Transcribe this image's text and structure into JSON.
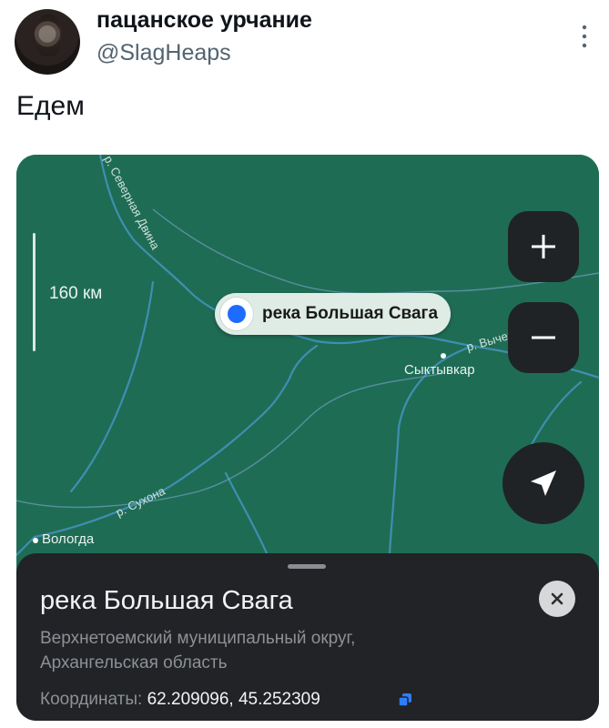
{
  "tweet": {
    "display_name": "пацанское урчание",
    "handle": "@SlagHeaps",
    "text": "Едем"
  },
  "map": {
    "scale_label": "160 км",
    "selected_place_label": "река Большая Свага",
    "cities": {
      "syktyvkar": "Сыктывкар",
      "vologda": "Вологда"
    },
    "rivers": {
      "severnaya_dvina": "р. Северная Двина",
      "sukhona": "р. Сухона",
      "vychegda": "р. Вычегда"
    },
    "colors": {
      "land": "#1f6c55",
      "river": "#3e8fb0",
      "border": "#6f9fbf",
      "pin_accent": "#1e6cff"
    }
  },
  "place_card": {
    "title": "река Большая Свага",
    "address": "Верхнетоемский муниципальный округ, Архангельская область",
    "coords_label": "Координаты:",
    "coords_value": "62.209096, 45.252309"
  },
  "icons": {
    "zoom_in": "plus-icon",
    "zoom_out": "minus-icon",
    "locate": "navigation-arrow-icon",
    "close": "close-icon",
    "copy": "copy-icon",
    "more": "more-vertical-icon"
  }
}
